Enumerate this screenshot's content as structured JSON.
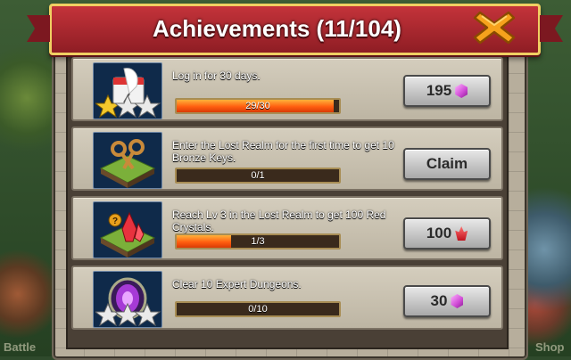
{
  "title": "Achievements (11/104)",
  "colors": {
    "banner": "#b0282f",
    "progress_fill": "#ff6a10",
    "gem": "#d04bd6",
    "red_crystal": "#c0121e"
  },
  "background": {
    "left_label": "Battle",
    "right_label": "Shop"
  },
  "achievements": [
    {
      "description": "Log in for 30 days.",
      "progress_text": "29/30",
      "progress": 0.967,
      "icon": "calendar-quill-icon",
      "reward_label": "195",
      "reward_icon": "gem-icon",
      "stars": 2
    },
    {
      "description": "Enter the Lost Realm for the first time to get 10 Bronze Keys.",
      "progress_text": "0/1",
      "progress": 0,
      "icon": "bronze-keys-icon",
      "reward_label": "Claim",
      "reward_icon": "",
      "stars": 0
    },
    {
      "description": "Reach Lv 3 in the Lost Realm to get 100 Red Crystals.",
      "progress_text": "1/3",
      "progress": 0.333,
      "icon": "red-crystal-island-icon",
      "reward_label": "100",
      "reward_icon": "red-crystal-icon",
      "stars": 0
    },
    {
      "description": "Clear 10 Expert Dungeons.",
      "progress_text": "0/10",
      "progress": 0,
      "icon": "dungeon-portal-icon",
      "reward_label": "30",
      "reward_icon": "gem-icon",
      "stars": 3
    }
  ]
}
